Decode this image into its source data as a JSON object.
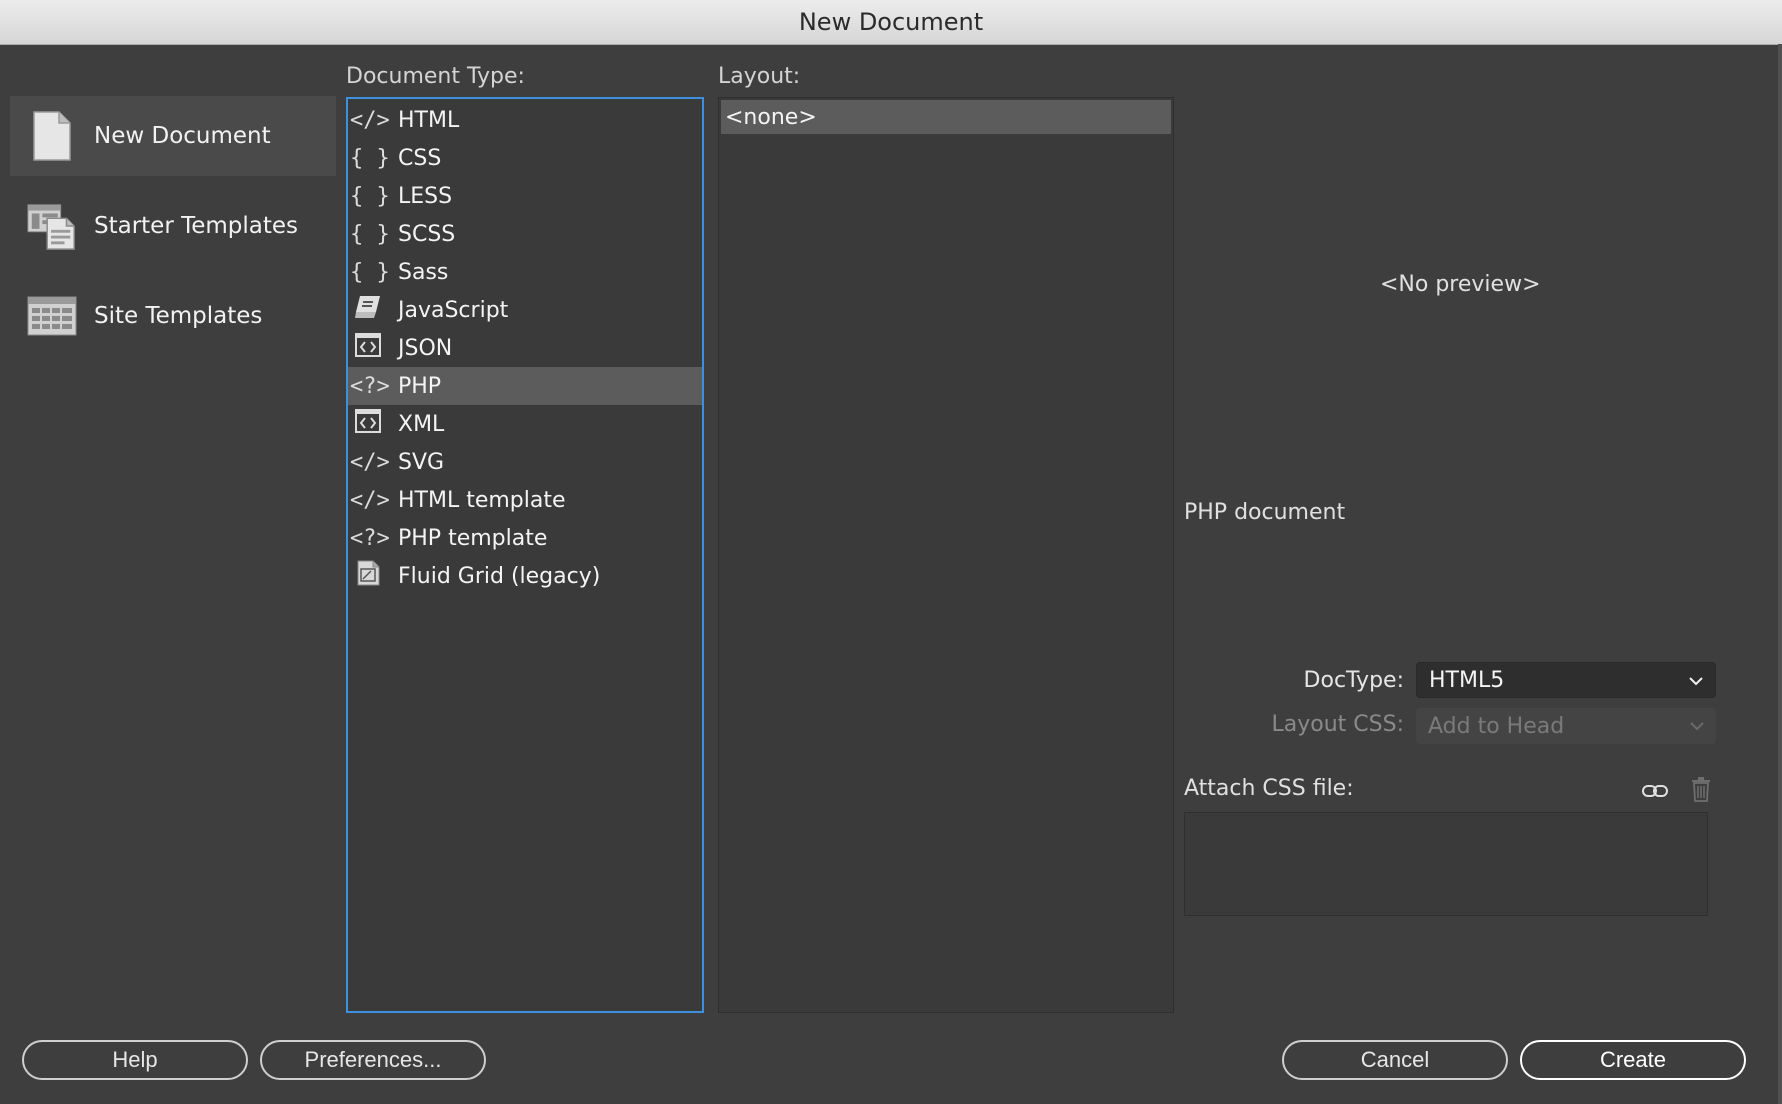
{
  "window": {
    "title": "New Document"
  },
  "sidebar": {
    "items": [
      {
        "label": "New Document",
        "icon": "document-icon",
        "active": true
      },
      {
        "label": "Starter Templates",
        "icon": "starter-templates-icon",
        "active": false
      },
      {
        "label": "Site Templates",
        "icon": "site-templates-icon",
        "active": false
      }
    ]
  },
  "document_type": {
    "label": "Document Type:",
    "items": [
      {
        "label": "HTML",
        "glyph": "</>",
        "icon": "code-tag-icon"
      },
      {
        "label": "CSS",
        "glyph": "{ }",
        "icon": "braces-icon"
      },
      {
        "label": "LESS",
        "glyph": "{ }",
        "icon": "braces-icon"
      },
      {
        "label": "SCSS",
        "glyph": "{ }",
        "icon": "braces-icon"
      },
      {
        "label": "Sass",
        "glyph": "{ }",
        "icon": "braces-icon"
      },
      {
        "label": "JavaScript",
        "glyph": "",
        "icon": "script-scroll-icon"
      },
      {
        "label": "JSON",
        "glyph": "",
        "icon": "boxed-code-icon"
      },
      {
        "label": "PHP",
        "glyph": "<?>",
        "icon": "php-tag-icon",
        "selected": true
      },
      {
        "label": "XML",
        "glyph": "",
        "icon": "boxed-code-icon"
      },
      {
        "label": "SVG",
        "glyph": "</>",
        "icon": "code-tag-icon"
      },
      {
        "label": "HTML template",
        "glyph": "</>",
        "icon": "code-tag-icon"
      },
      {
        "label": "PHP template",
        "glyph": "<?>",
        "icon": "php-tag-icon"
      },
      {
        "label": "Fluid Grid (legacy)",
        "glyph": "",
        "icon": "fluid-grid-icon"
      }
    ]
  },
  "layout": {
    "label": "Layout:",
    "items": [
      {
        "label": "<none>",
        "selected": true
      }
    ]
  },
  "preview": {
    "placeholder": "<No preview>",
    "description": "PHP document"
  },
  "options": {
    "doctype_label": "DocType:",
    "doctype_value": "HTML5",
    "layout_css_label": "Layout CSS:",
    "layout_css_value": "Add to Head",
    "attach_css_label": "Attach CSS file:"
  },
  "buttons": {
    "help": "Help",
    "preferences": "Preferences...",
    "cancel": "Cancel",
    "create": "Create"
  },
  "colors": {
    "background": "#3e3e3e",
    "selection": "#5c5c5c",
    "focus_border": "#3d8fe0"
  }
}
